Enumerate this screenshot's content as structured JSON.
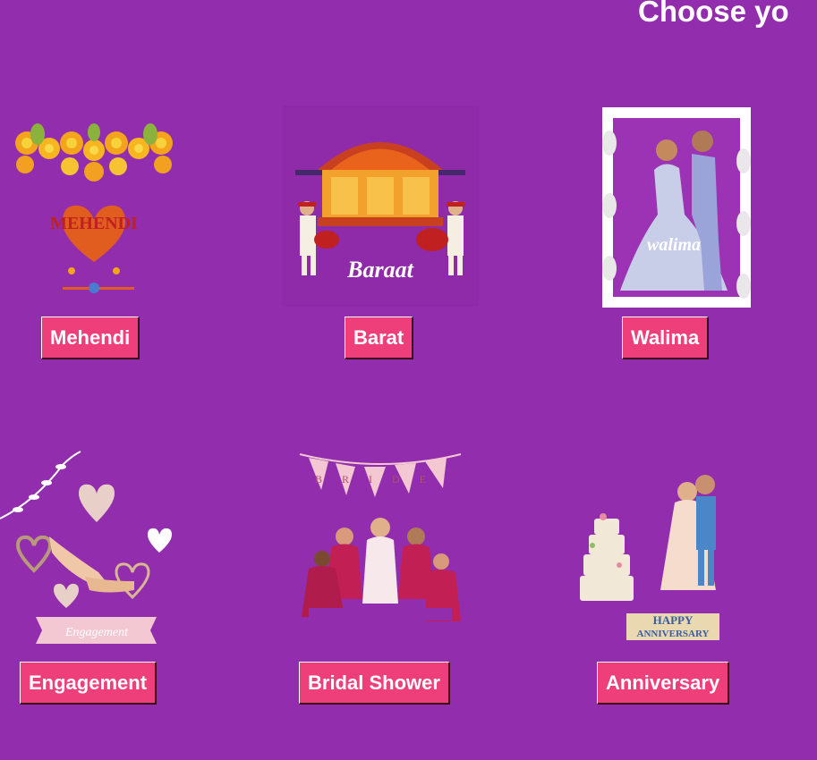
{
  "page": {
    "heading": "Choose yo",
    "background": "#922ead",
    "button_color": "#ef3f7b"
  },
  "events": [
    {
      "label": "Mehendi",
      "art_text": "MEHENDI",
      "icon": "mehendi-illustration"
    },
    {
      "label": "Barat",
      "art_text": "Baraat",
      "icon": "baraat-illustration"
    },
    {
      "label": "Walima",
      "art_text": "walima",
      "icon": "walima-illustration"
    },
    {
      "label": "Engagement",
      "art_text": "Engagement",
      "icon": "engagement-illustration"
    },
    {
      "label": "Bridal Shower",
      "art_text": "BRIDE",
      "icon": "bridal-shower-illustration"
    },
    {
      "label": "Anniversary",
      "art_text_1": "HAPPY",
      "art_text_2": "ANNIVERSARY",
      "icon": "anniversary-illustration"
    }
  ]
}
